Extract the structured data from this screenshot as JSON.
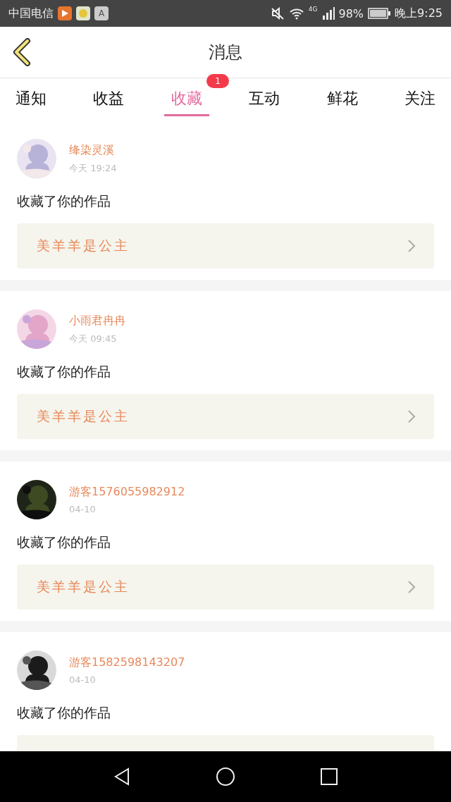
{
  "status_bar": {
    "carrier": "中国电信",
    "app_badge": "A",
    "network": "4G",
    "battery": "98%",
    "time": "晚上9:25"
  },
  "header": {
    "title": "消息"
  },
  "tabs": [
    {
      "label": "通知",
      "selected": false
    },
    {
      "label": "收益",
      "selected": false
    },
    {
      "label": "收藏",
      "selected": true,
      "badge": "1"
    },
    {
      "label": "互动",
      "selected": false
    },
    {
      "label": "鲜花",
      "selected": false
    },
    {
      "label": "关注",
      "selected": false
    }
  ],
  "messages": [
    {
      "user": "绛染灵溪",
      "time": "今天 19:24",
      "text": "收藏了你的作品",
      "work": "美羊羊是公主"
    },
    {
      "user": "小雨君冉冉",
      "time": "今天 09:45",
      "text": "收藏了你的作品",
      "work": "美羊羊是公主"
    },
    {
      "user": "游客1576055982912",
      "time": "04-10",
      "text": "收藏了你的作品",
      "work": "美羊羊是公主"
    },
    {
      "user": "游客1582598143207",
      "time": "04-10",
      "text": "收藏了你的作品"
    }
  ]
}
